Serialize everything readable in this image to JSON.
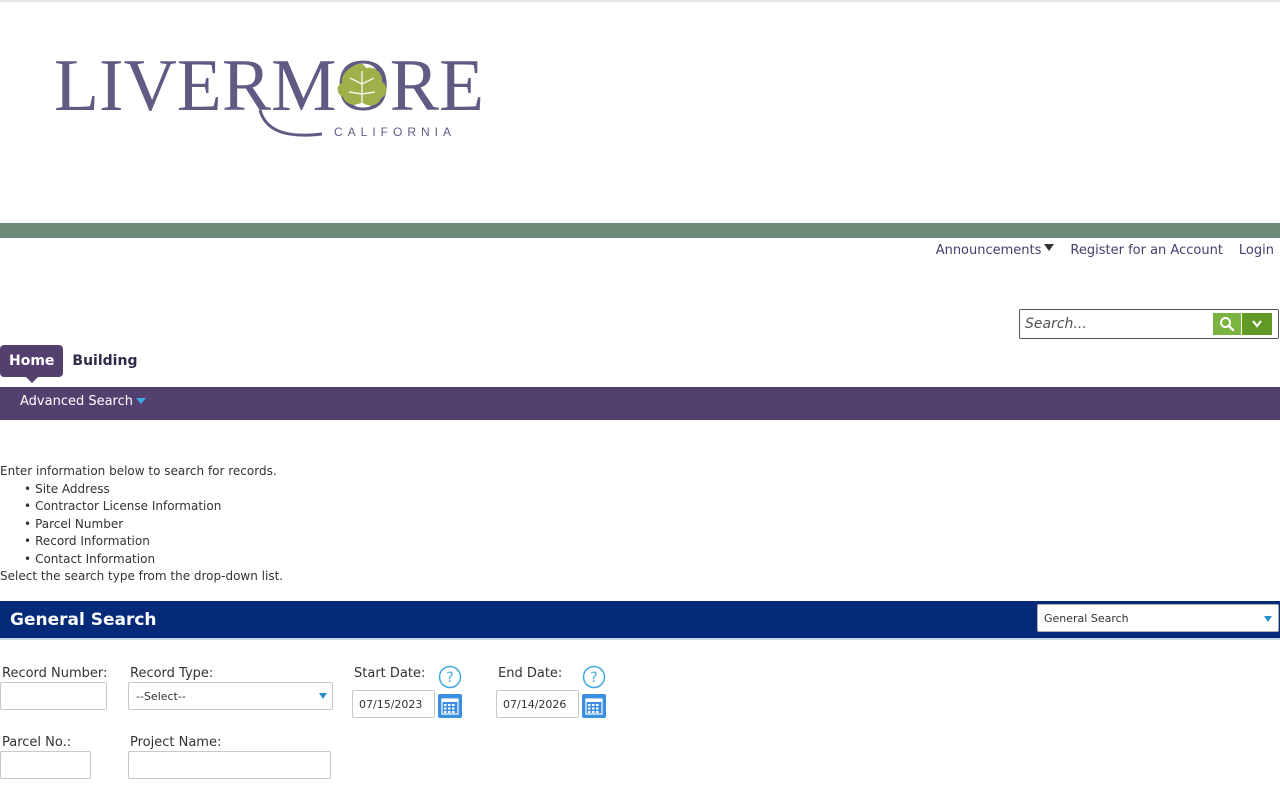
{
  "logo": {
    "name": "LIVERMORE",
    "subtitle": "CALIFORNIA",
    "brand_color": "#635a84",
    "leaf_color": "#9db04a"
  },
  "utility_nav": {
    "announcements": "Announcements",
    "register": "Register for an Account",
    "login": "Login"
  },
  "global_search": {
    "placeholder": "Search..."
  },
  "tabs": [
    {
      "label": "Home",
      "active": true
    },
    {
      "label": "Building",
      "active": false
    }
  ],
  "subnav": {
    "advanced_search": "Advanced Search"
  },
  "intro": {
    "lead": "Enter information below to search for records.",
    "items": [
      "Site Address",
      "Contractor License Information",
      "Parcel Number",
      "Record Information",
      "Contact Information"
    ],
    "footer": "Select the search type from the drop-down list."
  },
  "general_search": {
    "title": "General Search",
    "search_type_selected": "General Search"
  },
  "form": {
    "record_number_label": "Record Number:",
    "record_type_label": "Record Type:",
    "record_type_selected": "--Select--",
    "start_date_label": "Start Date:",
    "start_date_value": "07/15/2023",
    "end_date_label": "End Date:",
    "end_date_value": "07/14/2026",
    "parcel_no_label": "Parcel No.:",
    "project_name_label": "Project Name:"
  },
  "colors": {
    "green_bar": "#6d8b78",
    "purple_nav": "#52406f",
    "blue_header": "#052a7a",
    "search_green": "#7ab33d",
    "calendar_blue": "#3b8fe0"
  }
}
